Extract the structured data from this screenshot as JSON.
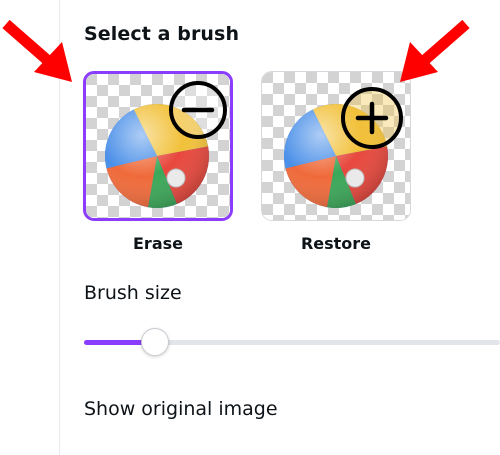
{
  "panel": {
    "title": "Select a brush",
    "brushes": [
      {
        "label": "Erase",
        "selected": true,
        "icon": "minus-circle-icon"
      },
      {
        "label": "Restore",
        "selected": false,
        "icon": "plus-circle-icon"
      }
    ],
    "brush_size": {
      "label": "Brush size",
      "value": 0.17
    },
    "show_original_label": "Show original image"
  },
  "colors": {
    "accent": "#8b3dff",
    "annotation_arrow": "#ff0000"
  }
}
